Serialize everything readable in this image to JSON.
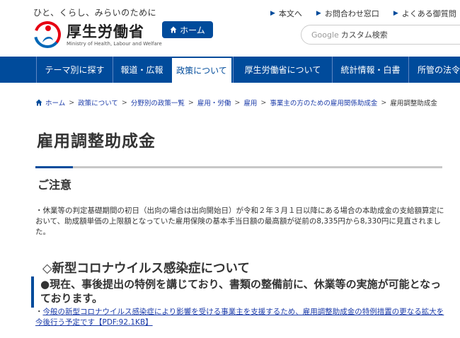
{
  "header": {
    "tagline": "ひと、くらし、みらいのために",
    "logo_ja": "厚生労働省",
    "logo_en": "Ministry of Health, Labour and Welfare",
    "home_button": "ホーム",
    "util_links": [
      "本文へ",
      "お問合わせ窓口",
      "よくある御質問"
    ],
    "search_brand": "Google",
    "search_placeholder": "カスタム検索"
  },
  "nav": {
    "items": [
      "テーマ別に探す",
      "報道・広報",
      "政策について",
      "厚生労働省について",
      "統計情報・白書",
      "所管の法令"
    ],
    "active_index": 2
  },
  "breadcrumb": [
    "ホーム",
    "政策について",
    "分野別の政策一覧",
    "雇用・労働",
    "雇用",
    "事業主の方のための雇用関係助成金",
    "雇用調整助成金"
  ],
  "main": {
    "title": "雇用調整助成金",
    "notice_heading": "ご注意",
    "notice_text": "・休業等の判定基礎期間の初日（出向の場合は出向開始日）が令和２年３月１日以降にある場合の本助成金の支給額算定において、助成額単価の上限額となっていた雇用保険の基本手当日額の最高額が従前の8,335円から8,330円に見直されました。",
    "corona_heading": "◇新型コロナウイルス感染症について",
    "highlight": "●現在、事後提出の特例を講じており、書類の整備前に、休業等の実施が可能となっております。",
    "link_prefix": "・",
    "link_text": "今般の新型コロナウイルス感染症により影響を受ける事業主を支援するため、雇用調整助成金の特例措置の更なる拡大を今後行う予定です【PDF:92.1KB】"
  },
  "colors": {
    "brand_blue": "#004b9b",
    "logo_red": "#e60012",
    "logo_blue": "#0068b7",
    "link": "#1a3aa8"
  }
}
